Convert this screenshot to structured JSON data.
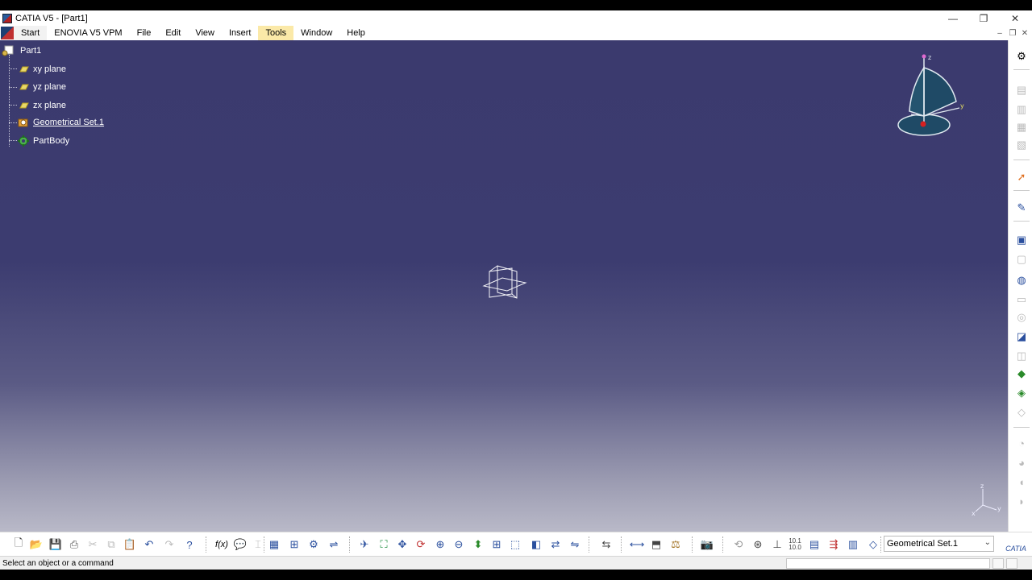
{
  "window": {
    "title": "CATIA V5 - [Part1]",
    "controls": {
      "minimize": "—",
      "restore": "❐",
      "close": "✕"
    }
  },
  "menubar": {
    "items": [
      "Start",
      "ENOVIA V5 VPM",
      "File",
      "Edit",
      "View",
      "Insert",
      "Tools",
      "Window",
      "Help"
    ],
    "hovered": "Tools",
    "mdi_controls": {
      "minimize": "–",
      "restore": "❐",
      "close": "✕"
    }
  },
  "tree": {
    "root": "Part1",
    "items": [
      {
        "label": "xy plane",
        "icon": "plane-icon"
      },
      {
        "label": "yz plane",
        "icon": "plane-icon"
      },
      {
        "label": "zx plane",
        "icon": "plane-icon"
      },
      {
        "label": "Geometrical Set.1",
        "icon": "geometrical-set-icon",
        "underlined": true
      },
      {
        "label": "PartBody",
        "icon": "gear-icon"
      }
    ]
  },
  "compass": {
    "x_label": "x",
    "y_label": "y",
    "z_label": "z"
  },
  "axis_triad": {
    "x_label": "x",
    "y_label": "y",
    "z_label": "z"
  },
  "toolbar": {
    "current_set": "Geometrical Set.1",
    "dimension_label": "10.1\n10.0"
  },
  "statusbar": {
    "message": "Select an object or a command"
  },
  "brand": {
    "logo_text": "CATIA"
  },
  "colors": {
    "viewport_top": "#3b3a6e",
    "viewport_bottom": "#b9b9c8",
    "compass_fill": "#1f4a66",
    "menu_hover": "#fbe9a8"
  }
}
